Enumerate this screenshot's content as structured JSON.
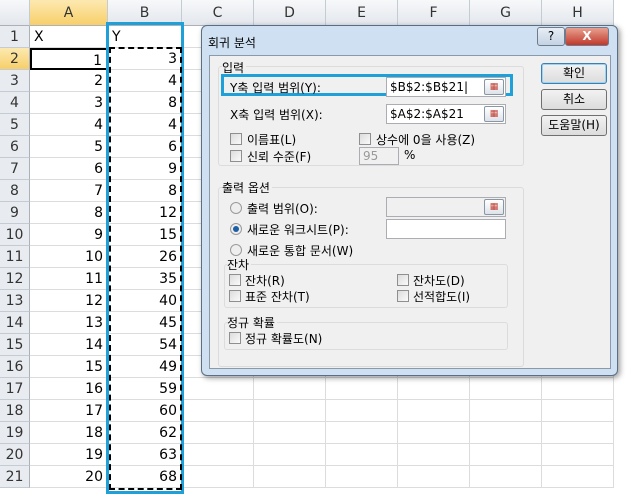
{
  "columns": [
    "A",
    "B",
    "C",
    "D",
    "E",
    "F",
    "G",
    "H"
  ],
  "rows": [
    [
      "X",
      "Y"
    ],
    [
      "1",
      "3"
    ],
    [
      "2",
      "4"
    ],
    [
      "3",
      "8"
    ],
    [
      "4",
      "4"
    ],
    [
      "5",
      "6"
    ],
    [
      "6",
      "9"
    ],
    [
      "7",
      "8"
    ],
    [
      "8",
      "12"
    ],
    [
      "9",
      "15"
    ],
    [
      "10",
      "26"
    ],
    [
      "11",
      "35"
    ],
    [
      "12",
      "40"
    ],
    [
      "13",
      "45"
    ],
    [
      "14",
      "54"
    ],
    [
      "15",
      "49"
    ],
    [
      "16",
      "59"
    ],
    [
      "17",
      "60"
    ],
    [
      "18",
      "62"
    ],
    [
      "19",
      "63"
    ],
    [
      "20",
      "68"
    ]
  ],
  "dialog": {
    "title": "회귀 분석",
    "help_btn": "?",
    "close_btn": "X",
    "input_group": "입력",
    "y_range_label": "Y축 입력 범위(Y):",
    "y_range_value": "$B$2:$B$21|",
    "x_range_label": "X축 입력 범위(X):",
    "x_range_value": "$A$2:$A$21",
    "labels_cb": "이름표(L)",
    "const_zero_cb": "상수에 0을 사용(Z)",
    "confidence_cb": "신뢰 수준(F)",
    "confidence_value": "95",
    "percent": "%",
    "output_group": "출력 옵션",
    "output_range": "출력 범위(O):",
    "new_sheet": "새로운 워크시트(P):",
    "new_workbook": "새로운 통합 문서(W)",
    "residuals_group": "잔차",
    "residuals": "잔차(R)",
    "std_residuals": "표준 잔차(T)",
    "residual_plots": "잔차도(D)",
    "line_fit": "선적합도(I)",
    "normal_group": "정규 확률",
    "normal_plot": "정규 확률도(N)",
    "ok": "확인",
    "cancel": "취소",
    "help": "도움말(H)",
    "ref_icon": "range-select-icon"
  }
}
